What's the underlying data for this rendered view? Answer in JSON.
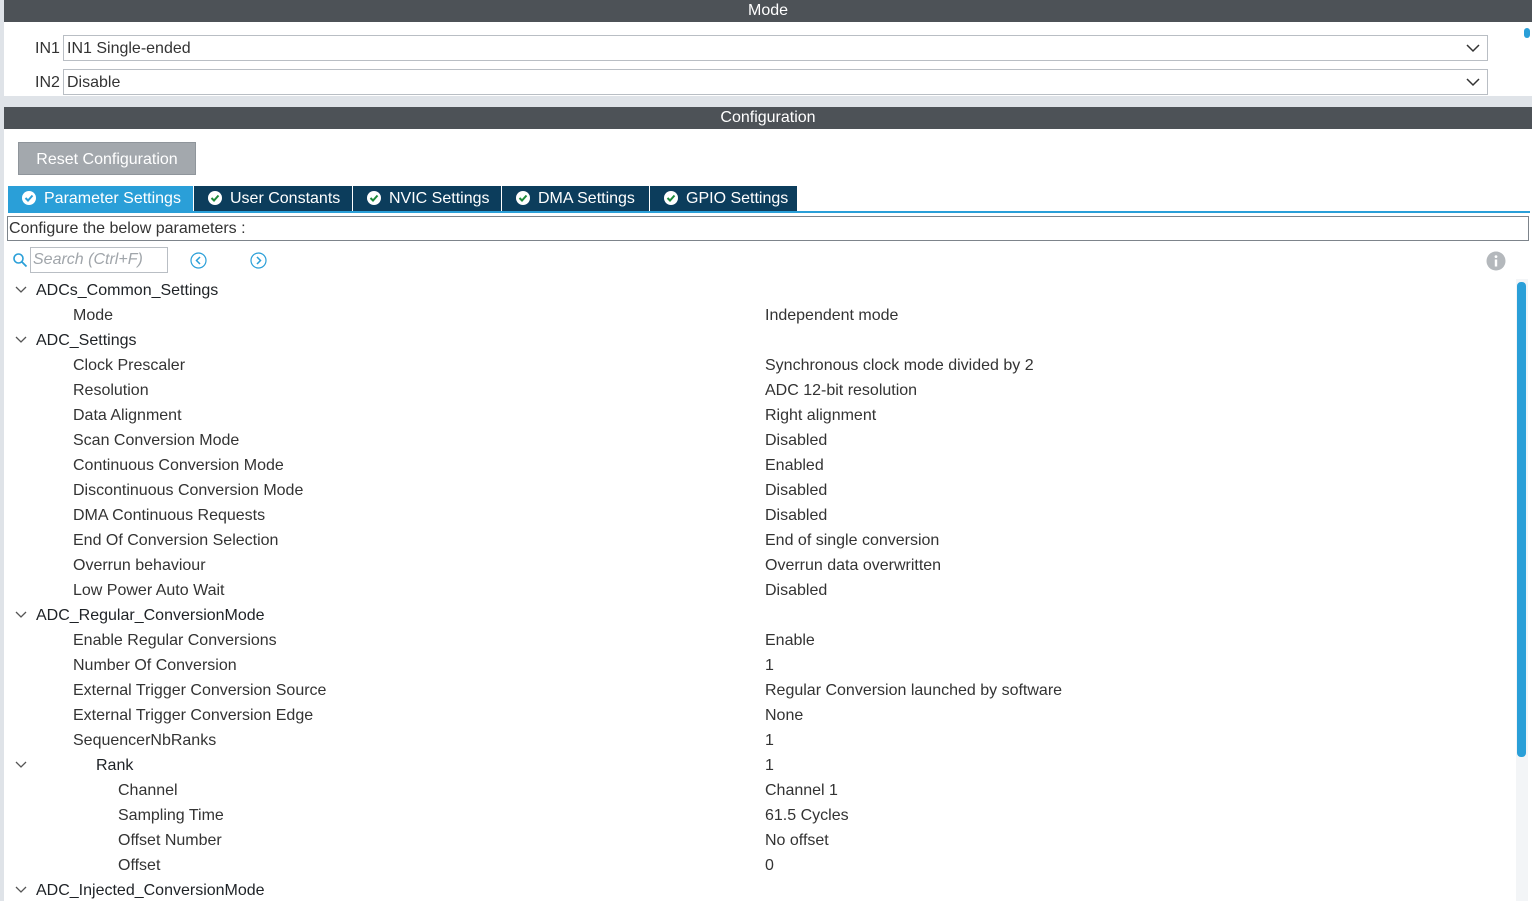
{
  "mode_section": {
    "title": "Mode",
    "rows": [
      {
        "label": "IN1",
        "value": "IN1 Single-ended"
      },
      {
        "label": "IN2",
        "value": "Disable"
      }
    ]
  },
  "config_section": {
    "title": "Configuration",
    "reset_label": "Reset Configuration",
    "tabs": [
      {
        "label": "Parameter Settings",
        "active": true
      },
      {
        "label": "User Constants",
        "active": false
      },
      {
        "label": "NVIC Settings",
        "active": false
      },
      {
        "label": "DMA Settings",
        "active": false
      },
      {
        "label": "GPIO Settings",
        "active": false
      }
    ],
    "description": "Configure the below parameters :",
    "search_placeholder": "Search (Ctrl+F)"
  },
  "tree": [
    {
      "name": "ADCs_Common_Settings",
      "value": "",
      "group": true,
      "depth": 0
    },
    {
      "name": "Mode",
      "value": "Independent mode",
      "group": false,
      "depth": 1
    },
    {
      "name": "ADC_Settings",
      "value": "",
      "group": true,
      "depth": 0
    },
    {
      "name": "Clock Prescaler",
      "value": "Synchronous clock mode divided by 2",
      "group": false,
      "depth": 1
    },
    {
      "name": "Resolution",
      "value": "ADC 12-bit resolution",
      "group": false,
      "depth": 1
    },
    {
      "name": "Data Alignment",
      "value": "Right alignment",
      "group": false,
      "depth": 1
    },
    {
      "name": "Scan Conversion Mode",
      "value": "Disabled",
      "group": false,
      "depth": 1
    },
    {
      "name": "Continuous Conversion Mode",
      "value": "Enabled",
      "group": false,
      "depth": 1
    },
    {
      "name": "Discontinuous Conversion Mode",
      "value": "Disabled",
      "group": false,
      "depth": 1
    },
    {
      "name": "DMA Continuous Requests",
      "value": "Disabled",
      "group": false,
      "depth": 1
    },
    {
      "name": "End Of Conversion Selection",
      "value": "End of single conversion",
      "group": false,
      "depth": 1
    },
    {
      "name": "Overrun behaviour",
      "value": "Overrun data overwritten",
      "group": false,
      "depth": 1
    },
    {
      "name": "Low Power Auto Wait",
      "value": "Disabled",
      "group": false,
      "depth": 1
    },
    {
      "name": "ADC_Regular_ConversionMode",
      "value": "",
      "group": true,
      "depth": 0
    },
    {
      "name": "Enable Regular Conversions",
      "value": "Enable",
      "group": false,
      "depth": 1
    },
    {
      "name": "Number Of Conversion",
      "value": "1",
      "group": false,
      "depth": 1
    },
    {
      "name": "External Trigger Conversion Source",
      "value": "Regular Conversion launched by software",
      "group": false,
      "depth": 1
    },
    {
      "name": "External Trigger Conversion Edge",
      "value": "None",
      "group": false,
      "depth": 1
    },
    {
      "name": "SequencerNbRanks",
      "value": "1",
      "group": false,
      "depth": 1
    },
    {
      "name": "Rank",
      "value": "1",
      "group": true,
      "depth": 2
    },
    {
      "name": "Channel",
      "value": "Channel 1",
      "group": false,
      "depth": 3
    },
    {
      "name": "Sampling Time",
      "value": "61.5 Cycles",
      "group": false,
      "depth": 3
    },
    {
      "name": "Offset Number",
      "value": "No offset",
      "group": false,
      "depth": 3
    },
    {
      "name": "Offset",
      "value": "0",
      "group": false,
      "depth": 3
    },
    {
      "name": "ADC_Injected_ConversionMode",
      "value": "",
      "group": true,
      "depth": 0
    }
  ]
}
